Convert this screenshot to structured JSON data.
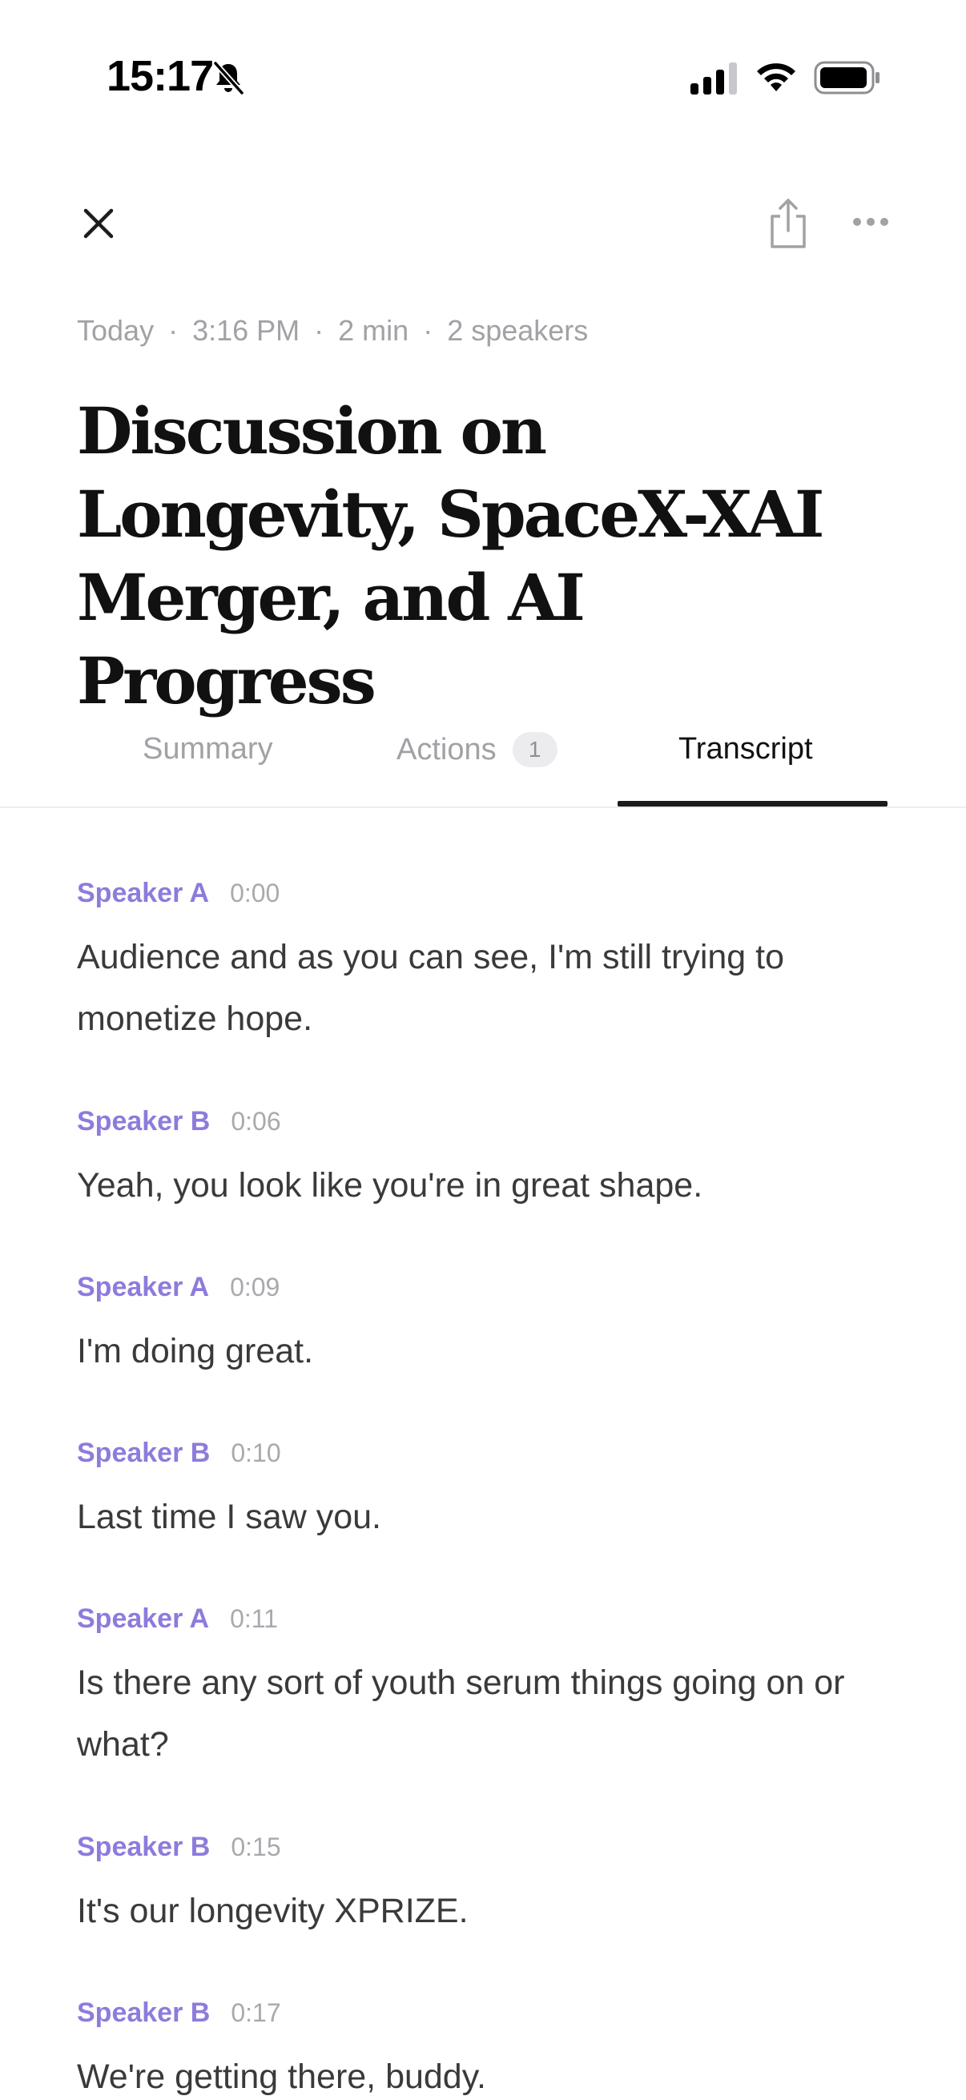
{
  "status_bar": {
    "time": "15:17",
    "icons": [
      "bell-slash-icon",
      "cellular-signal-icon",
      "wifi-icon",
      "battery-icon"
    ]
  },
  "header": {
    "icons": [
      "close-icon",
      "share-icon",
      "more-horizontal-icon"
    ]
  },
  "meta": {
    "day": "Today",
    "time": "3:16 PM",
    "duration": "2 min",
    "speakers": "2 speakers",
    "separator": "·"
  },
  "title": "Discussion on Longevity, SpaceX-XAI Merger, and AI Progress",
  "tabs": {
    "summary": "Summary",
    "actions": "Actions",
    "actions_count": "1",
    "transcript": "Transcript",
    "active": "transcript"
  },
  "transcript": [
    {
      "speaker": "Speaker A",
      "time": "0:00",
      "text": "Audience and as you can see, I'm still trying to monetize hope."
    },
    {
      "speaker": "Speaker B",
      "time": "0:06",
      "text": "Yeah, you look like you're in great shape."
    },
    {
      "speaker": "Speaker A",
      "time": "0:09",
      "text": "I'm doing great."
    },
    {
      "speaker": "Speaker B",
      "time": "0:10",
      "text": "Last time I saw you."
    },
    {
      "speaker": "Speaker A",
      "time": "0:11",
      "text": "Is there any sort of youth serum things going on or what?"
    },
    {
      "speaker": "Speaker B",
      "time": "0:15",
      "text": "It's our longevity XPRIZE."
    },
    {
      "speaker": "Speaker B",
      "time": "0:17",
      "text": "We're getting there, buddy."
    }
  ],
  "colors": {
    "speaker": "#8e7bdc",
    "muted": "#a1a1a6",
    "text": "#3a3a3c",
    "active_tab": "#1c1c1e"
  }
}
